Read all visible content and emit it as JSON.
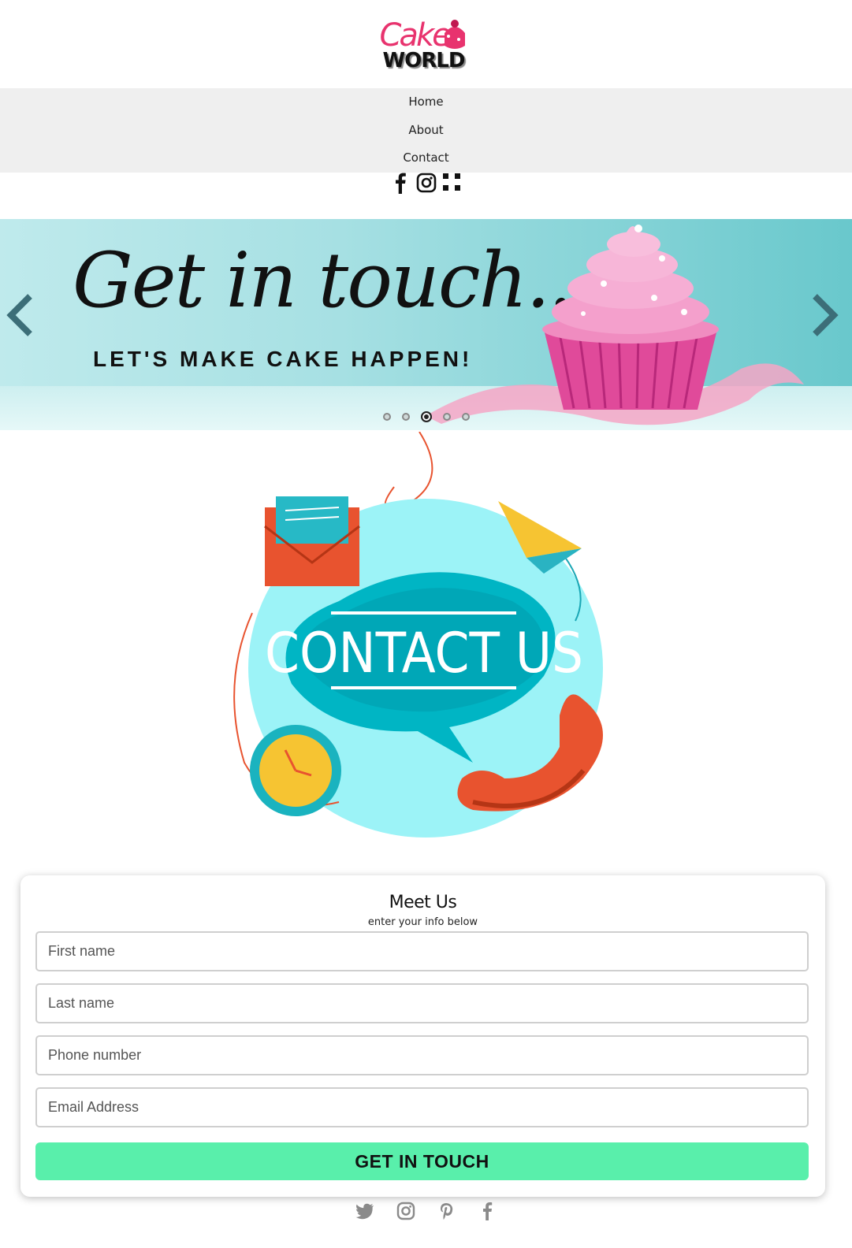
{
  "brand": {
    "logo_top": "Cake",
    "logo_bottom": "WORLD"
  },
  "nav": {
    "items": [
      "Home",
      "About",
      "Contact"
    ]
  },
  "social_top": [
    "facebook-icon",
    "instagram-icon",
    "menu-grid-icon"
  ],
  "hero": {
    "title": "Get in touch...",
    "subtitle": "LET'S MAKE CAKE HAPPEN!",
    "slide_count": 5,
    "active_slide": 3
  },
  "contact_art": {
    "text": "CONTACT US"
  },
  "form": {
    "title": "Meet Us",
    "subtitle": "enter your info below",
    "first_name_placeholder": "First name",
    "last_name_placeholder": "Last name",
    "phone_placeholder": "Phone number",
    "email_placeholder": "Email Address",
    "submit_label": "GET IN TOUCH"
  },
  "social_bottom": [
    "twitter-icon",
    "instagram-icon",
    "pinterest-icon",
    "facebook-icon"
  ],
  "colors": {
    "accent": "#59efab",
    "brand": "#e8336e",
    "hero_bg": "#a6e0e3"
  }
}
